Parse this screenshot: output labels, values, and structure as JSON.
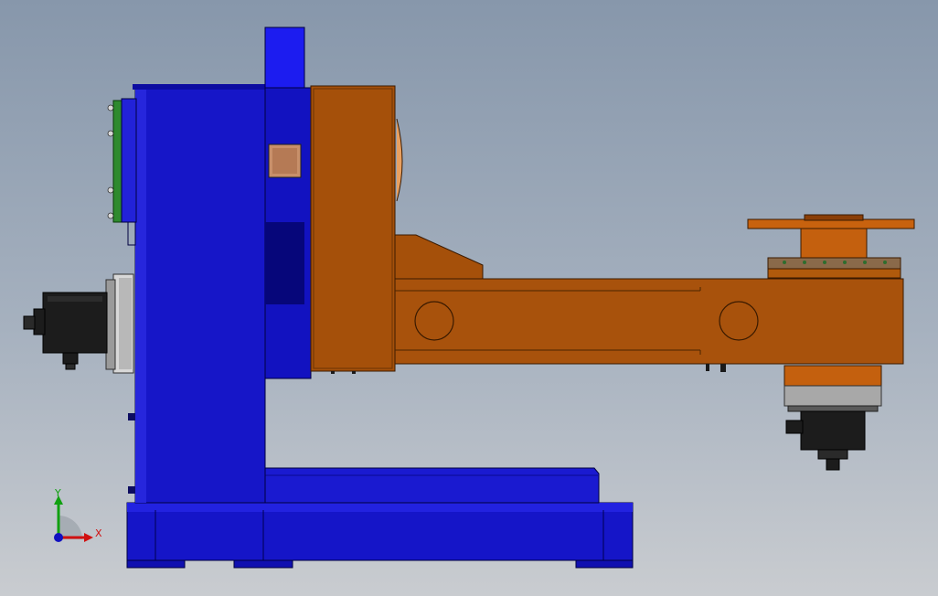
{
  "viewport": {
    "background_top": "#8797ab",
    "background_bottom": "#c9ccd0"
  },
  "model": {
    "frame_color": "#1010c0",
    "arm_color": "#a5500a",
    "motor_color": "#1c1c1c",
    "flange_color": "#c8c8c8",
    "ring_color": "#2e8a2e"
  },
  "triad": {
    "x_label": "X",
    "y_label": "Y",
    "x_color": "#d01010",
    "y_color": "#10a010",
    "z_color": "#1010c0"
  }
}
